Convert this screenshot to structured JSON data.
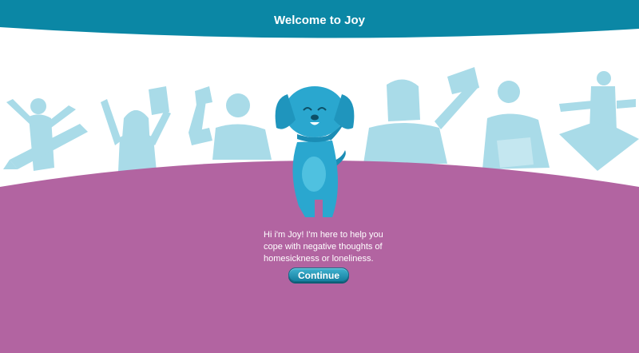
{
  "header": {
    "title": "Welcome to Joy"
  },
  "intro": {
    "message": "Hi i'm Joy! I'm here to help you cope with negative thoughts of homesickness or loneliness."
  },
  "actions": {
    "continue_label": "Continue"
  },
  "colors": {
    "header_bg": "#0b87a5",
    "figures": "#a9dbe8",
    "ground": "#b264a1",
    "mascot": "#2aa7cf",
    "mascot_dark": "#1b8db5",
    "button": "#2a9fc2"
  },
  "illustration": {
    "figures": [
      "kid-with-pencil",
      "girl-with-paper",
      "waving-boy",
      "waving-man",
      "boy-with-book",
      "girl-reading-book"
    ],
    "mascot": "joy-dog"
  }
}
